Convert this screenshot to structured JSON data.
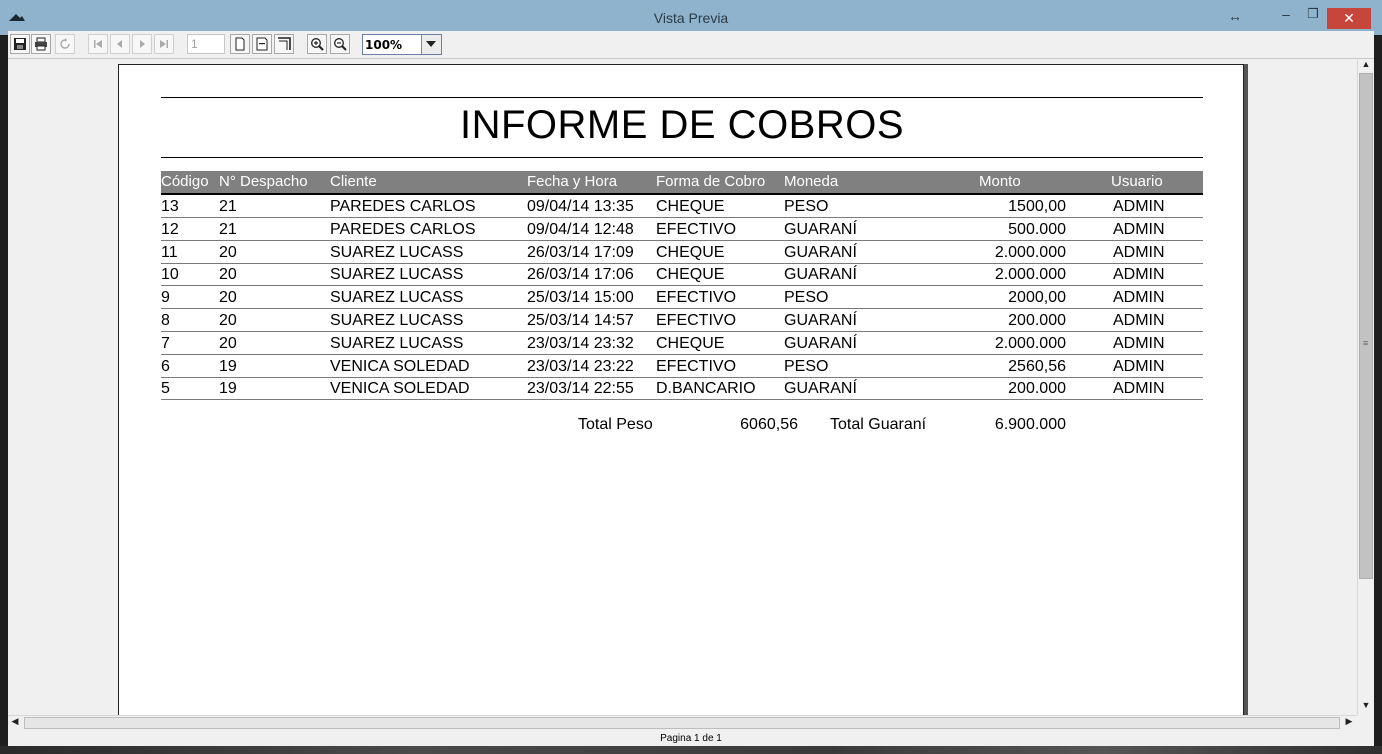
{
  "window": {
    "title": "Vista Previa",
    "close_label": "✕",
    "minimize_label": "–",
    "maximize_label": "❐",
    "resize_label": "↔"
  },
  "toolbar": {
    "page_number": "1",
    "zoom": "100%",
    "icons": [
      "save-icon",
      "print-icon",
      "refresh-icon",
      "first-page-icon",
      "prev-page-icon",
      "next-page-icon",
      "last-page-icon",
      "single-page-icon",
      "page-width-icon",
      "two-pages-icon",
      "zoom-in-icon",
      "zoom-out-icon"
    ]
  },
  "report": {
    "title": "INFORME DE COBROS",
    "columns": [
      "Código",
      "N° Despacho",
      "Cliente",
      "Fecha y Hora",
      "Forma de Cobro",
      "Moneda",
      "Monto",
      "Usuario"
    ],
    "rows": [
      {
        "codigo": "13",
        "despacho": "21",
        "cliente": "PAREDES CARLOS",
        "fecha": "09/04/14 13:35",
        "forma": "CHEQUE",
        "moneda": "PESO",
        "monto": "1500,00",
        "usuario": "ADMIN"
      },
      {
        "codigo": "12",
        "despacho": "21",
        "cliente": "PAREDES CARLOS",
        "fecha": "09/04/14 12:48",
        "forma": "EFECTIVO",
        "moneda": "GUARANÍ",
        "monto": "500.000",
        "usuario": "ADMIN"
      },
      {
        "codigo": "11",
        "despacho": "20",
        "cliente": "SUAREZ LUCASS",
        "fecha": "26/03/14 17:09",
        "forma": "CHEQUE",
        "moneda": "GUARANÍ",
        "monto": "2.000.000",
        "usuario": "ADMIN"
      },
      {
        "codigo": "10",
        "despacho": "20",
        "cliente": "SUAREZ LUCASS",
        "fecha": "26/03/14 17:06",
        "forma": "CHEQUE",
        "moneda": "GUARANÍ",
        "monto": "2.000.000",
        "usuario": "ADMIN"
      },
      {
        "codigo": "9",
        "despacho": "20",
        "cliente": "SUAREZ LUCASS",
        "fecha": "25/03/14 15:00",
        "forma": "EFECTIVO",
        "moneda": "PESO",
        "monto": "2000,00",
        "usuario": "ADMIN"
      },
      {
        "codigo": "8",
        "despacho": "20",
        "cliente": "SUAREZ LUCASS",
        "fecha": "25/03/14 14:57",
        "forma": "EFECTIVO",
        "moneda": "GUARANÍ",
        "monto": "200.000",
        "usuario": "ADMIN"
      },
      {
        "codigo": "7",
        "despacho": "20",
        "cliente": "SUAREZ LUCASS",
        "fecha": "23/03/14 23:32",
        "forma": "CHEQUE",
        "moneda": "GUARANÍ",
        "monto": "2.000.000",
        "usuario": "ADMIN"
      },
      {
        "codigo": "6",
        "despacho": "19",
        "cliente": "VENICA SOLEDAD",
        "fecha": "23/03/14 23:22",
        "forma": "EFECTIVO",
        "moneda": "PESO",
        "monto": "2560,56",
        "usuario": "ADMIN"
      },
      {
        "codigo": "5",
        "despacho": "19",
        "cliente": "VENICA SOLEDAD",
        "fecha": "23/03/14 22:55",
        "forma": "D.BANCARIO",
        "moneda": "GUARANÍ",
        "monto": "200.000",
        "usuario": "ADMIN"
      }
    ],
    "totals": {
      "peso_label": "Total Peso",
      "peso_value": "6060,56",
      "guarani_label": "Total Guaraní",
      "guarani_value": "6.900.000"
    }
  },
  "status": {
    "page_info": "Pagina 1 de 1"
  },
  "colors": {
    "titlebar": "#8fb3cc",
    "close_button": "#c7463b",
    "header_band": "#808080"
  }
}
